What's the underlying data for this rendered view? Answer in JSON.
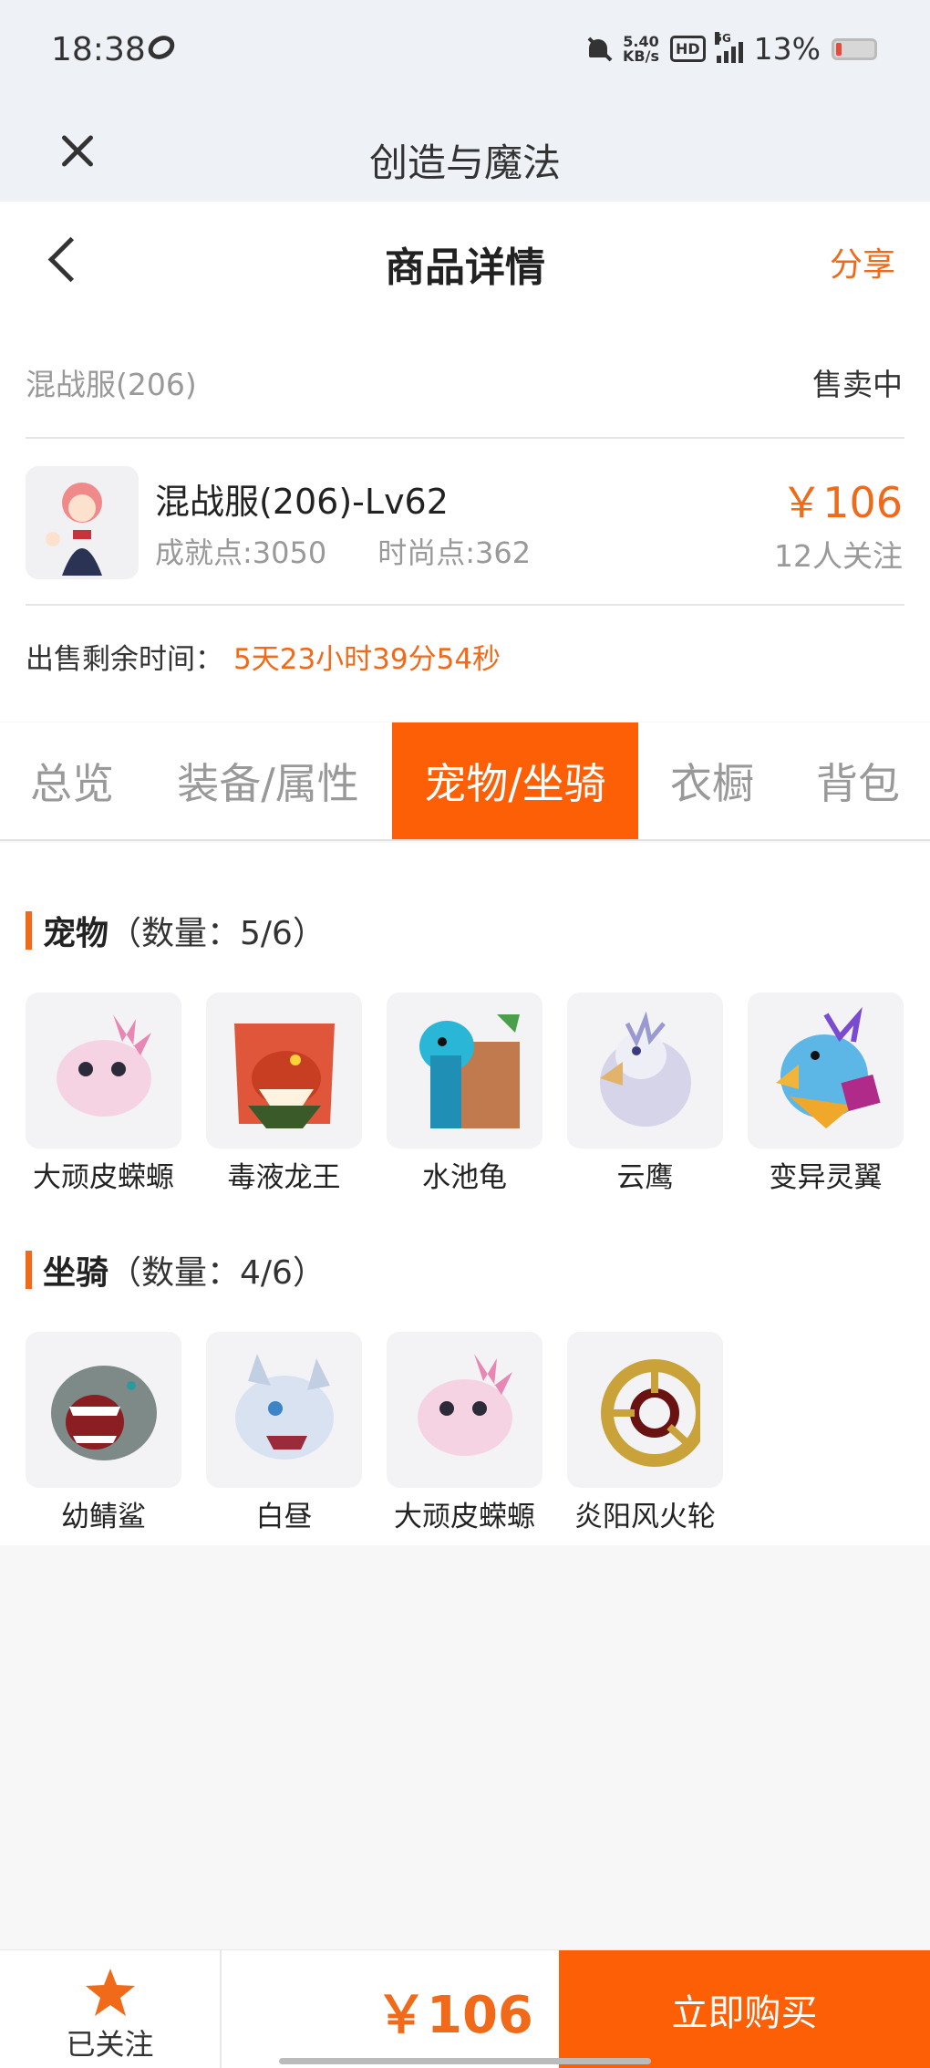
{
  "status_bar": {
    "time": "18:38",
    "net_speed_value": "5.40",
    "net_speed_unit": "KB/s",
    "hd": "HD",
    "network": "5G",
    "battery": "13%"
  },
  "app": {
    "title": "创造与魔法"
  },
  "header": {
    "title": "商品详情",
    "share_label": "分享"
  },
  "listing": {
    "server": "混战服(206)",
    "status": "售卖中",
    "character_name": "混战服(206)-Lv62",
    "achievement_points": "成就点:3050",
    "fashion_points": "时尚点:362",
    "price": "￥106",
    "followers": "12人关注",
    "time_left_label": "出售剩余时间：",
    "time_left_value": "5天23小时39分54秒"
  },
  "tabs": [
    {
      "label": "总览",
      "active": false
    },
    {
      "label": "装备/属性",
      "active": false
    },
    {
      "label": "宠物/坐骑",
      "active": true
    },
    {
      "label": "衣橱",
      "active": false
    },
    {
      "label": "背包",
      "active": false
    }
  ],
  "pets": {
    "title": "宠物",
    "count_label": "（数量：5/6）",
    "items": [
      {
        "name": "大顽皮蝾螈",
        "icon": "axolotl-icon",
        "color": "#f6d3e3"
      },
      {
        "name": "毒液龙王",
        "icon": "dragon-icon",
        "color": "#e0563a"
      },
      {
        "name": "水池龟",
        "icon": "turtle-icon",
        "color": "#2ab6d6"
      },
      {
        "name": "云鹰",
        "icon": "eagle-icon",
        "color": "#c9c8e2"
      },
      {
        "name": "变异灵翼",
        "icon": "griffin-icon",
        "color": "#5db7e6"
      }
    ]
  },
  "mounts": {
    "title": "坐骑",
    "count_label": "（数量：4/6）",
    "items": [
      {
        "name": "幼鲭鲨",
        "icon": "shark-icon",
        "color": "#7e8a88"
      },
      {
        "name": "白昼",
        "icon": "white-dragon-icon",
        "color": "#d8e2f0"
      },
      {
        "name": "大顽皮蝾螈",
        "icon": "axolotl-icon",
        "color": "#f6d3e3"
      },
      {
        "name": "炎阳风火轮",
        "icon": "fire-wheel-icon",
        "color": "#c9a33a"
      }
    ]
  },
  "bottom": {
    "follow_label": "已关注",
    "price": "￥106",
    "buy_label": "立即购买"
  },
  "colors": {
    "accent": "#fd5f07",
    "price": "#f06a1a"
  }
}
